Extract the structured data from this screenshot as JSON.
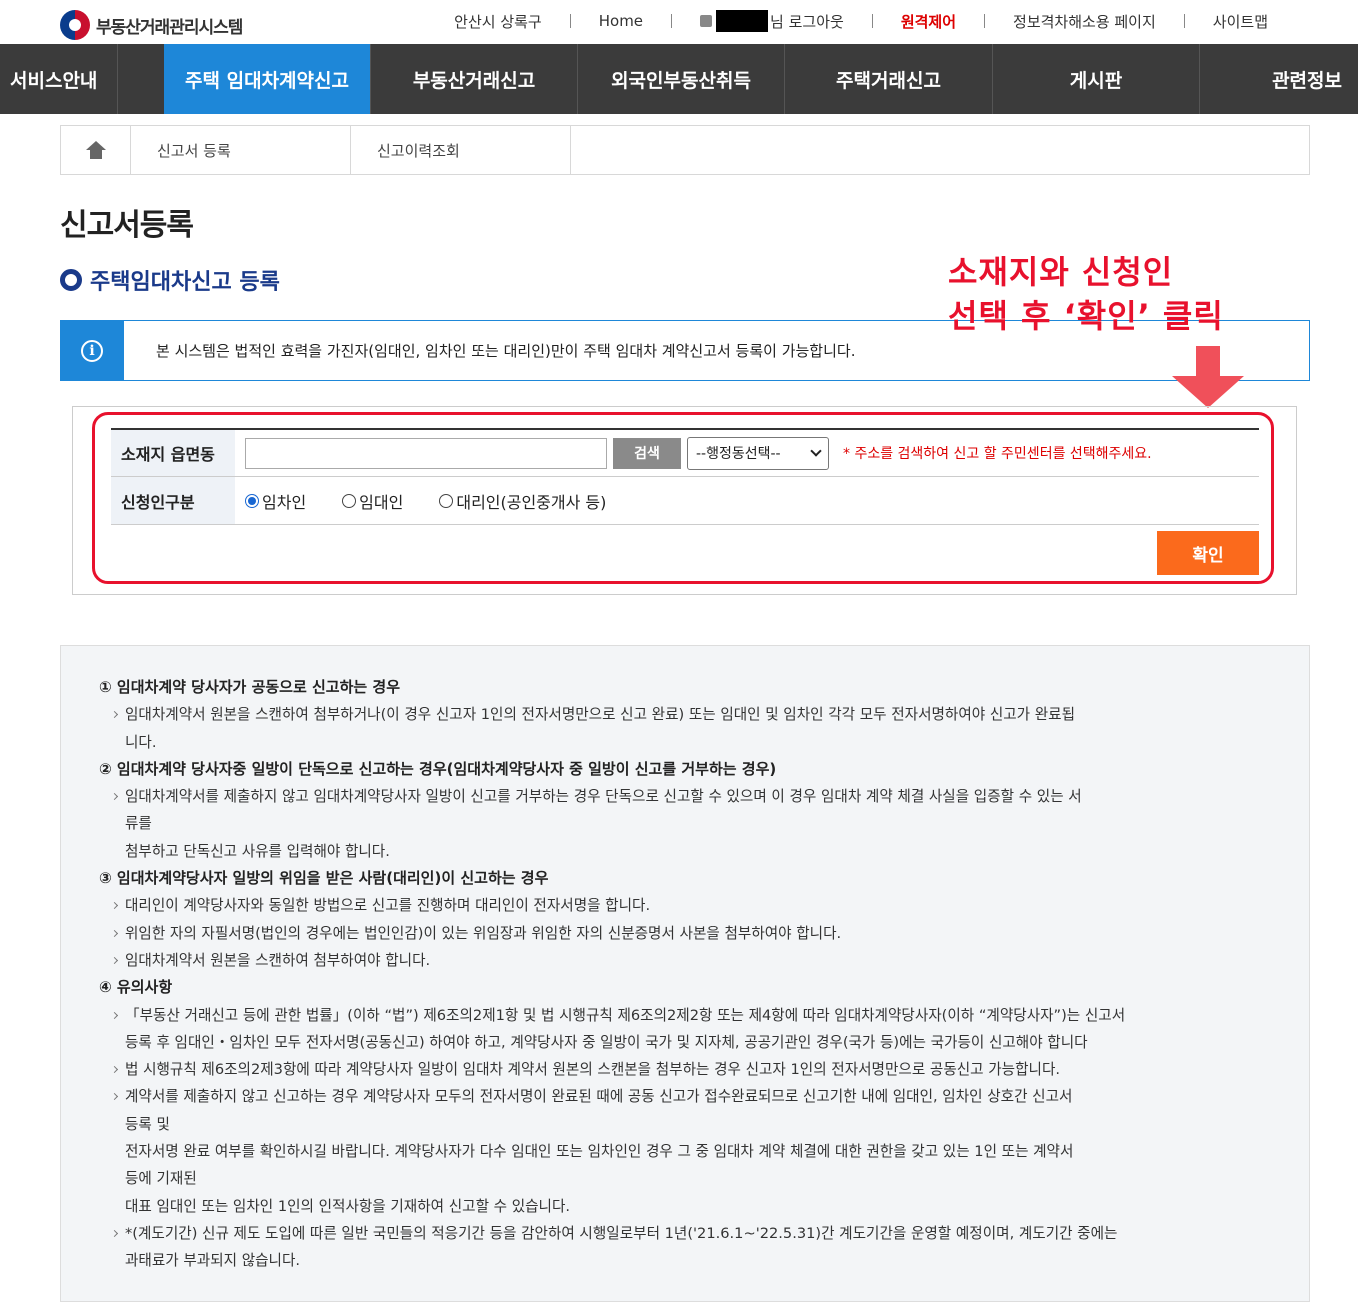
{
  "header": {
    "logo_text": "부동산거래관리시스템",
    "util": {
      "region": "안산시 상록구",
      "home": "Home",
      "user_suffix": "님 로그아웃",
      "remote": "원격제어",
      "info_gap": "정보격차해소용 페이지",
      "sitemap": "사이트맵"
    }
  },
  "gnb": [
    {
      "label": "서비스안내"
    },
    {
      "label": "주택 임대차계약신고"
    },
    {
      "label": "부동산거래신고"
    },
    {
      "label": "외국인부동산취득"
    },
    {
      "label": "주택거래신고"
    },
    {
      "label": "게시판"
    },
    {
      "label": "관련정보"
    }
  ],
  "subtabs": [
    {
      "label": "신고서 등록"
    },
    {
      "label": "신고이력조회"
    }
  ],
  "page_title": "신고서등록",
  "section_title": "주택임대차신고 등록",
  "notice": "본 시스템은 법적인 효력을 가진자(임대인, 임차인 또는 대리인)만이 주택 임대차 계약신고서 등록이 가능합니다.",
  "annotation": {
    "line1": "소재지와 신청인",
    "line2": "선택 후 ‘확인’ 클릭"
  },
  "form": {
    "address_label": "소재지 읍면동",
    "address_value": "",
    "search_label": "검색",
    "select_value": "--행정동선택--",
    "hint": "* 주소를 검색하여 신고 할 주민센터를 선택해주세요.",
    "applicant_label": "신청인구분",
    "options": [
      {
        "label": "임차인",
        "checked": true
      },
      {
        "label": "임대인",
        "checked": false
      },
      {
        "label": "대리인(공인중개사 등)",
        "checked": false
      }
    ],
    "confirm_label": "확인"
  },
  "guide": {
    "s1_head": "① 임대차계약 당사자가 공동으로 신고하는 경우",
    "s1_a": "임대차계약서 원본을 스캔하여 첨부하거나(이 경우 신고자 1인의 전자서명만으로 신고 완료) 또는 임대인 및 임차인 각각 모두 전자서명하여야 신고가 완료됩",
    "s1_a2": "니다.",
    "s2_head": "② 임대차계약 당사자중 일방이 단독으로 신고하는 경우(임대차계약당사자 중 일방이 신고를 거부하는 경우)",
    "s2_a": "임대차계약서를 제출하지 않고 임대차계약당사자 일방이 신고를 거부하는 경우 단독으로 신고할 수 있으며 이 경우 임대차 계약 체결 사실을 입증할 수 있는 서",
    "s2_a2": "류를",
    "s2_a3": "첨부하고 단독신고 사유를 입력해야 합니다.",
    "s3_head": "③ 임대차계약당사자 일방의 위임을 받은 사람(대리인)이 신고하는 경우",
    "s3_a": "대리인이 계약당사자와 동일한 방법으로 신고를 진행하며 대리인이 전자서명을 합니다.",
    "s3_b": "위임한 자의 자필서명(법인의 경우에는 법인인감)이 있는 위임장과 위임한 자의 신분증명서 사본을 첨부하여야 합니다.",
    "s3_c": "임대차계약서 원본을 스캔하여 첨부하여야 합니다.",
    "s4_head": "④ 유의사항",
    "s4_a": "「부동산 거래신고 등에 관한 법률」(이하 “법”) 제6조의2제1항 및 법 시행규칙 제6조의2제2항 또는 제4항에 따라 임대차계약당사자(이하 “계약당사자”)는 신고서",
    "s4_a2": "등록 후 임대인・임차인 모두 전자서명(공동신고) 하여야 하고, 계약당사자 중 일방이 국가 및 지자체, 공공기관인 경우(국가 등)에는 국가등이 신고해야 합니다",
    "s4_b": "법 시행규칙 제6조의2제3항에 따라 계약당사자 일방이 임대차 계약서 원본의 스캔본을 첨부하는 경우 신고자 1인의 전자서명만으로 공동신고 가능합니다.",
    "s4_c": "계약서를 제출하지 않고 신고하는 경우 계약당사자 모두의 전자서명이 완료된 때에 공동 신고가 접수완료되므로 신고기한 내에 임대인, 임차인 상호간 신고서",
    "s4_c2": "등록 및",
    "s4_c3": "전자서명 완료 여부를 확인하시길 바랍니다. 계약당사자가 다수 임대인 또는 임차인인 경우 그 중 임대차 계약 체결에 대한 권한을 갖고 있는 1인 또는 계약서",
    "s4_c4": "등에 기재된",
    "s4_c5": "대표 임대인 또는 임차인 1인의 인적사항을 기재하여 신고할 수 있습니다.",
    "s4_d": "*(계도기간) 신규 제도 도입에 따른 일반 국민들의 적응기간 등을 감안하여 시행일로부터 1년('21.6.1~'22.5.31)간 계도기간을 운영할 예정이며, 계도기간 중에는",
    "s4_d2": "과태료가 부과되지 않습니다."
  }
}
